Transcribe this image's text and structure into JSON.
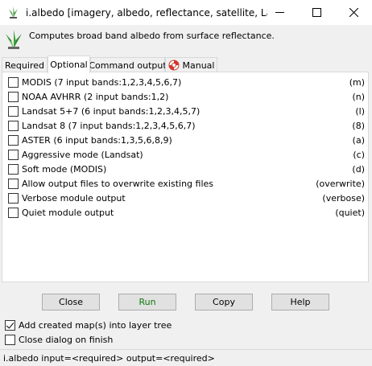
{
  "window": {
    "title": "i.albedo [imagery, albedo, reflectance, satellite, Lands..."
  },
  "module": {
    "description": "Computes broad band albedo from surface reflectance."
  },
  "tabs": [
    {
      "label": "Required",
      "active": false
    },
    {
      "label": "Optional",
      "active": true
    },
    {
      "label": "Command output",
      "active": false
    },
    {
      "label": "Manual",
      "active": false
    }
  ],
  "options": [
    {
      "label": "MODIS (7 input bands:1,2,3,4,5,6,7)",
      "flag": "(m)",
      "checked": false
    },
    {
      "label": "NOAA AVHRR (2 input bands:1,2)",
      "flag": "(n)",
      "checked": false
    },
    {
      "label": "Landsat 5+7 (6 input bands:1,2,3,4,5,7)",
      "flag": "(l)",
      "checked": false
    },
    {
      "label": "Landsat 8 (7 input bands:1,2,3,4,5,6,7)",
      "flag": "(8)",
      "checked": false
    },
    {
      "label": "ASTER (6 input bands:1,3,5,6,8,9)",
      "flag": "(a)",
      "checked": false
    },
    {
      "label": "Aggressive mode (Landsat)",
      "flag": "(c)",
      "checked": false
    },
    {
      "label": "Soft mode (MODIS)",
      "flag": "(d)",
      "checked": false
    },
    {
      "label": "Allow output files to overwrite existing files",
      "flag": "(overwrite)",
      "checked": false
    },
    {
      "label": "Verbose module output",
      "flag": "(verbose)",
      "checked": false
    },
    {
      "label": "Quiet module output",
      "flag": "(quiet)",
      "checked": false
    }
  ],
  "buttons": {
    "close": "Close",
    "run": "Run",
    "copy": "Copy",
    "help": "Help"
  },
  "bottom": {
    "add_to_tree": {
      "label": "Add created map(s) into layer tree",
      "checked": true
    },
    "close_on_finish": {
      "label": "Close dialog on finish",
      "checked": false
    }
  },
  "status": {
    "command": "i.albedo input=<required> output=<required>"
  },
  "colors": {
    "run_text": "#0a7a0a",
    "panel_bg": "#ffffff",
    "window_bg": "#f0f0f0"
  }
}
